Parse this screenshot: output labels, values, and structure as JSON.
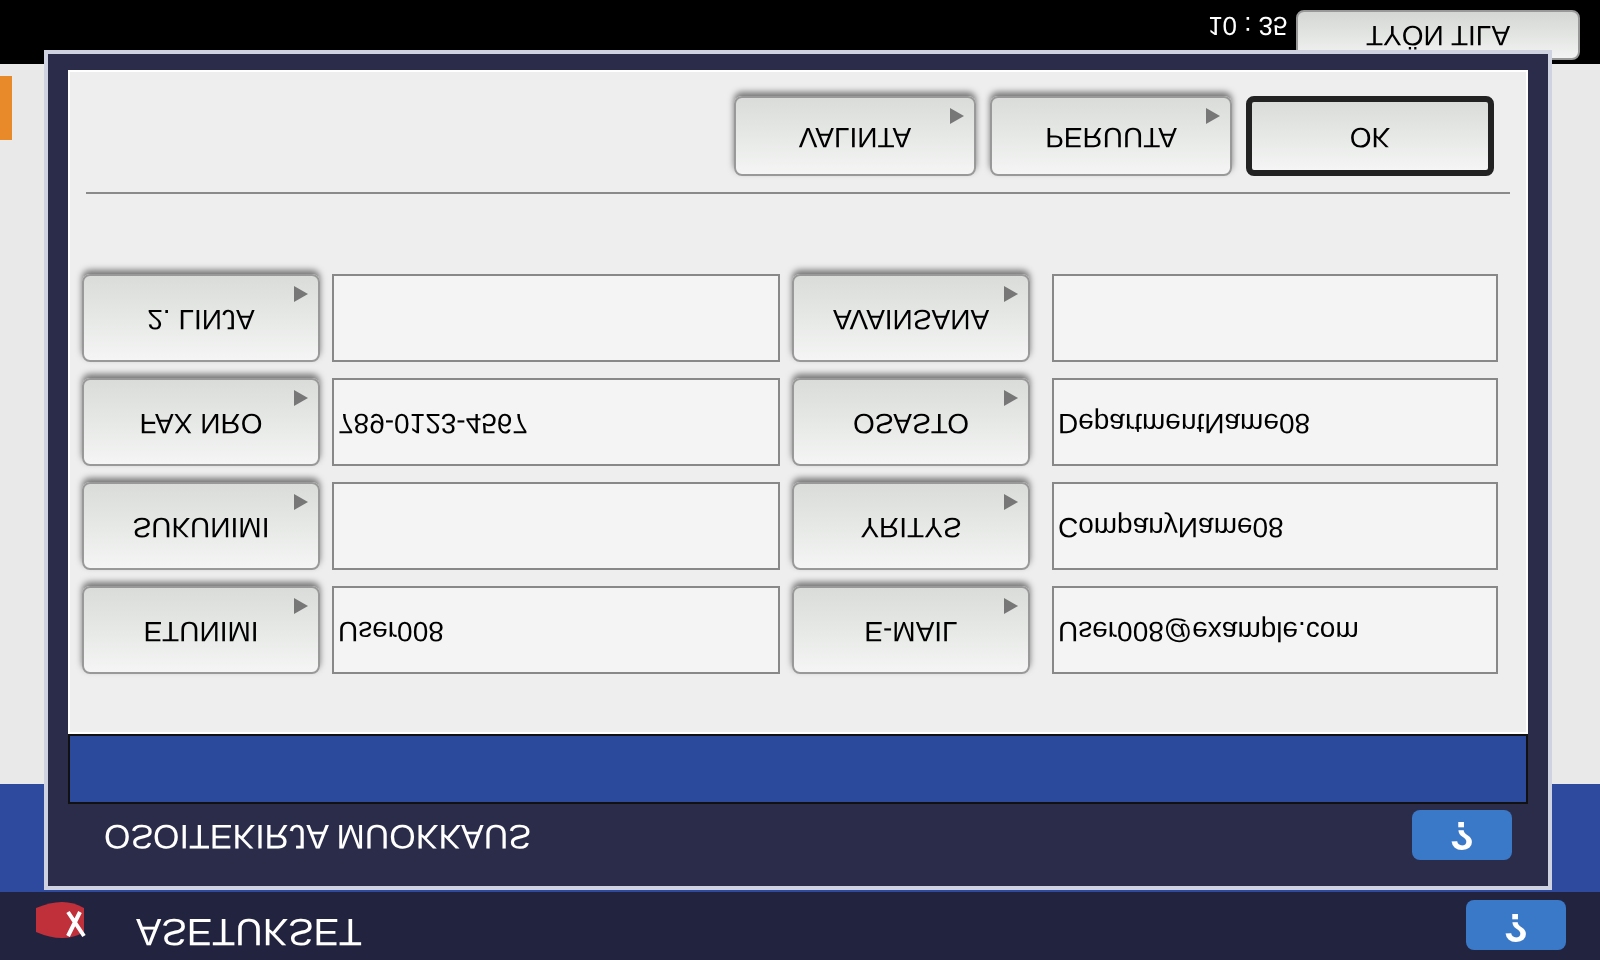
{
  "status_bar": {
    "time": "10 : 35",
    "job_status_button": "TYÖN TILA"
  },
  "dialog": {
    "buttons": [
      {
        "label": "VALINTA",
        "kind": "normal"
      },
      {
        "label": "PERUUTA",
        "kind": "normal"
      },
      {
        "label": "OK",
        "kind": "default"
      }
    ],
    "rows": [
      {
        "left": {
          "label": "2. LINJA"
        },
        "right": {
          "label": "AVAINSANA"
        }
      },
      {
        "left": {
          "label": "FAX NRO",
          "value": "789-0123-4567"
        },
        "right": {
          "label": "OSASTO",
          "value": "DepartmentName08"
        }
      },
      {
        "left": {
          "label": "SUKUNIMI"
        },
        "right": {
          "label": "YRITYS",
          "value": "CompanyName08"
        }
      },
      {
        "left": {
          "label": "ETUNIMI",
          "value": "User008"
        },
        "right": {
          "label": "E-MAIL",
          "value": "User008@example.com"
        }
      }
    ],
    "title": "OSOITEKIRJA MUOKKAUS",
    "help": "?"
  },
  "footer": {
    "title": "ASETUKSET",
    "help": "?"
  }
}
